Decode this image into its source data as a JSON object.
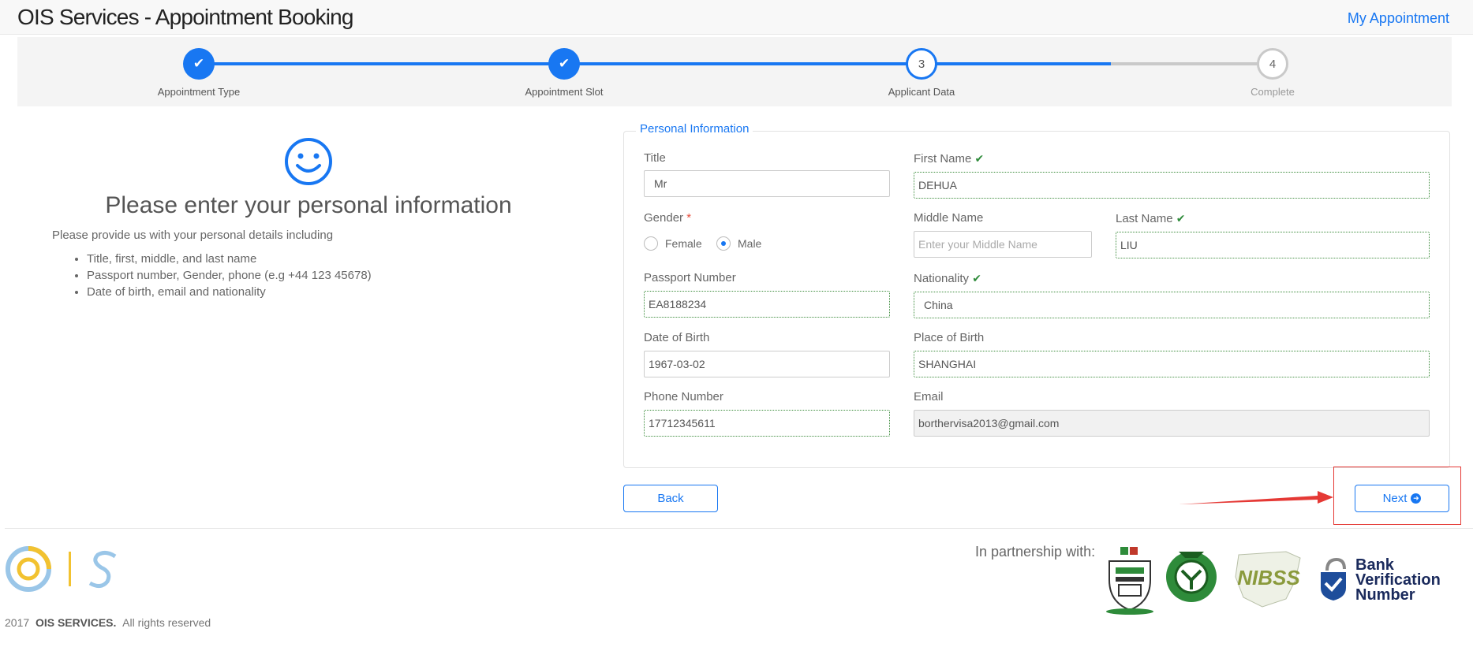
{
  "header": {
    "title": "OIS Services - Appointment Booking",
    "my_appointment": "My Appointment"
  },
  "wizard": {
    "steps": [
      {
        "number": "1",
        "label": "Appointment Type",
        "state": "done"
      },
      {
        "number": "2",
        "label": "Appointment Slot",
        "state": "done"
      },
      {
        "number": "3",
        "label": "Applicant Data",
        "state": "active"
      },
      {
        "number": "4",
        "label": "Complete",
        "state": "todo"
      }
    ],
    "check_glyph": "✔"
  },
  "intro": {
    "icon": "smiley-icon",
    "title": "Please enter your personal information",
    "subtitle": "Please provide us with your personal details including",
    "bullets": [
      "Title, first, middle, and last name",
      "Passport number, Gender, phone (e.g +44 123 45678)",
      "Date of birth, email and nationality"
    ]
  },
  "form": {
    "legend": "Personal Information",
    "title": {
      "label": "Title",
      "value": "Mr"
    },
    "first_name": {
      "label": "First Name",
      "value": "DEHUA"
    },
    "gender": {
      "label": "Gender",
      "required_mark": "*",
      "options": [
        "Female",
        "Male"
      ],
      "selected": "Male"
    },
    "middle_name": {
      "label": "Middle Name",
      "value": "",
      "placeholder": "Enter your Middle Name"
    },
    "last_name": {
      "label": "Last Name",
      "value": "LIU"
    },
    "passport": {
      "label": "Passport Number",
      "value": "EA8188234"
    },
    "nationality": {
      "label": "Nationality",
      "value": "China"
    },
    "dob": {
      "label": "Date of Birth",
      "value": "1967-03-02"
    },
    "pob": {
      "label": "Place of Birth",
      "value": "SHANGHAI"
    },
    "phone": {
      "label": "Phone Number",
      "value": "17712345611"
    },
    "email": {
      "label": "Email",
      "value": "borthervisa2013@gmail.com"
    },
    "valid_glyph": "✔"
  },
  "actions": {
    "back": "Back",
    "next": "Next",
    "next_icon": "➜"
  },
  "footer": {
    "logo_text": "I S",
    "copyright_year": "2017",
    "company": "OIS SERVICES.",
    "rights": "All rights reserved",
    "partnership": "In partnership with:",
    "partners": [
      "Nigeria Immigration Service",
      "Central Bank of Nigeria",
      "NIBSS",
      "Bank Verification Number"
    ],
    "nibss_text": "NIBSS",
    "bvn_lines": [
      "Bank",
      "Verification",
      "Number"
    ]
  },
  "colors": {
    "accent": "#1877f2",
    "valid": "#2e8b3a",
    "annotation": "#e53935"
  }
}
